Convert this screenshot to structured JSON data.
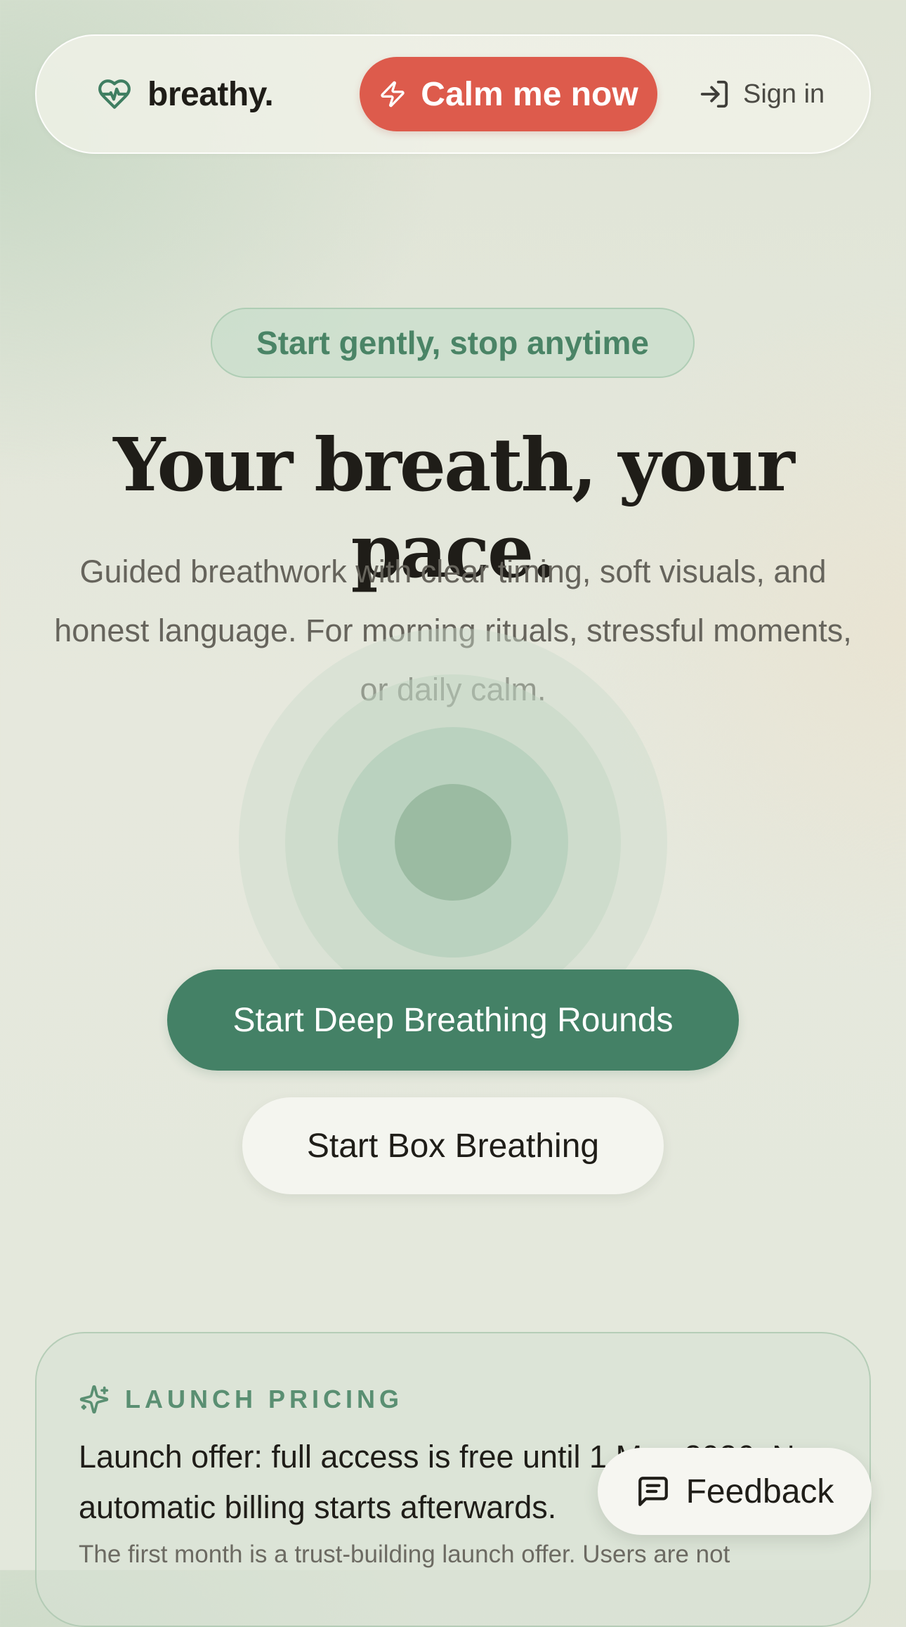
{
  "header": {
    "brand": "breathy.",
    "calm_label": "Calm me now",
    "signin_label": "Sign in"
  },
  "hero": {
    "pill": "Start gently, stop anytime",
    "title": "Your breath, your pace.",
    "subtitle": "Guided breathwork with clear timing, soft visuals, and honest language. For morning rituals, stressful moments, or daily calm.",
    "primary_cta": "Start Deep Breathing Rounds",
    "secondary_cta": "Start Box Breathing"
  },
  "pricing": {
    "label": "LAUNCH PRICING",
    "main": "Launch offer: full access is free until 1 May 2026. No automatic billing starts afterwards.",
    "note": "The first month is a trust-building launch offer. Users are not"
  },
  "feedback": {
    "label": "Feedback"
  },
  "colors": {
    "accent_green": "#448166",
    "calm_red": "#dd5b4c",
    "label_green": "#5a8f72"
  },
  "icons": {
    "brand": "heart-pulse-icon",
    "calm": "lightning-icon",
    "signin": "sign-in-icon",
    "pricing": "sparkle-icon",
    "feedback": "message-square-icon"
  }
}
